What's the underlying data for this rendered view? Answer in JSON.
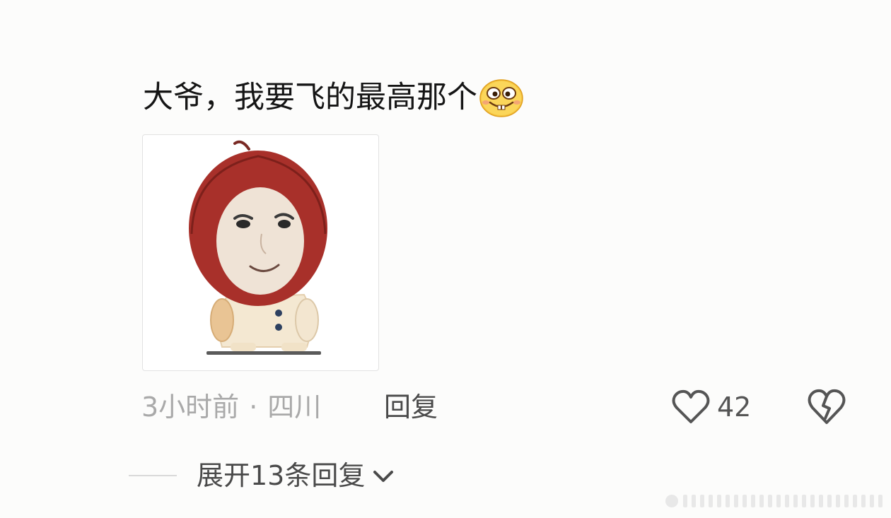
{
  "comment": {
    "text": "大爷，我要飞的最高那个",
    "emoji_icon": "grinning-buck-teeth-emoji-icon",
    "sticker": {
      "description_icon": "red-hood-meme-sticker"
    },
    "time": "3小时前",
    "separator": "·",
    "location": "四川",
    "reply_label": "回复",
    "like_count": "42",
    "expand_label": "展开13条回复"
  },
  "colors": {
    "text_primary": "#151515",
    "text_secondary": "#a9a9a9",
    "text_action": "#4a4a4a",
    "hood_red": "#a8302a"
  }
}
